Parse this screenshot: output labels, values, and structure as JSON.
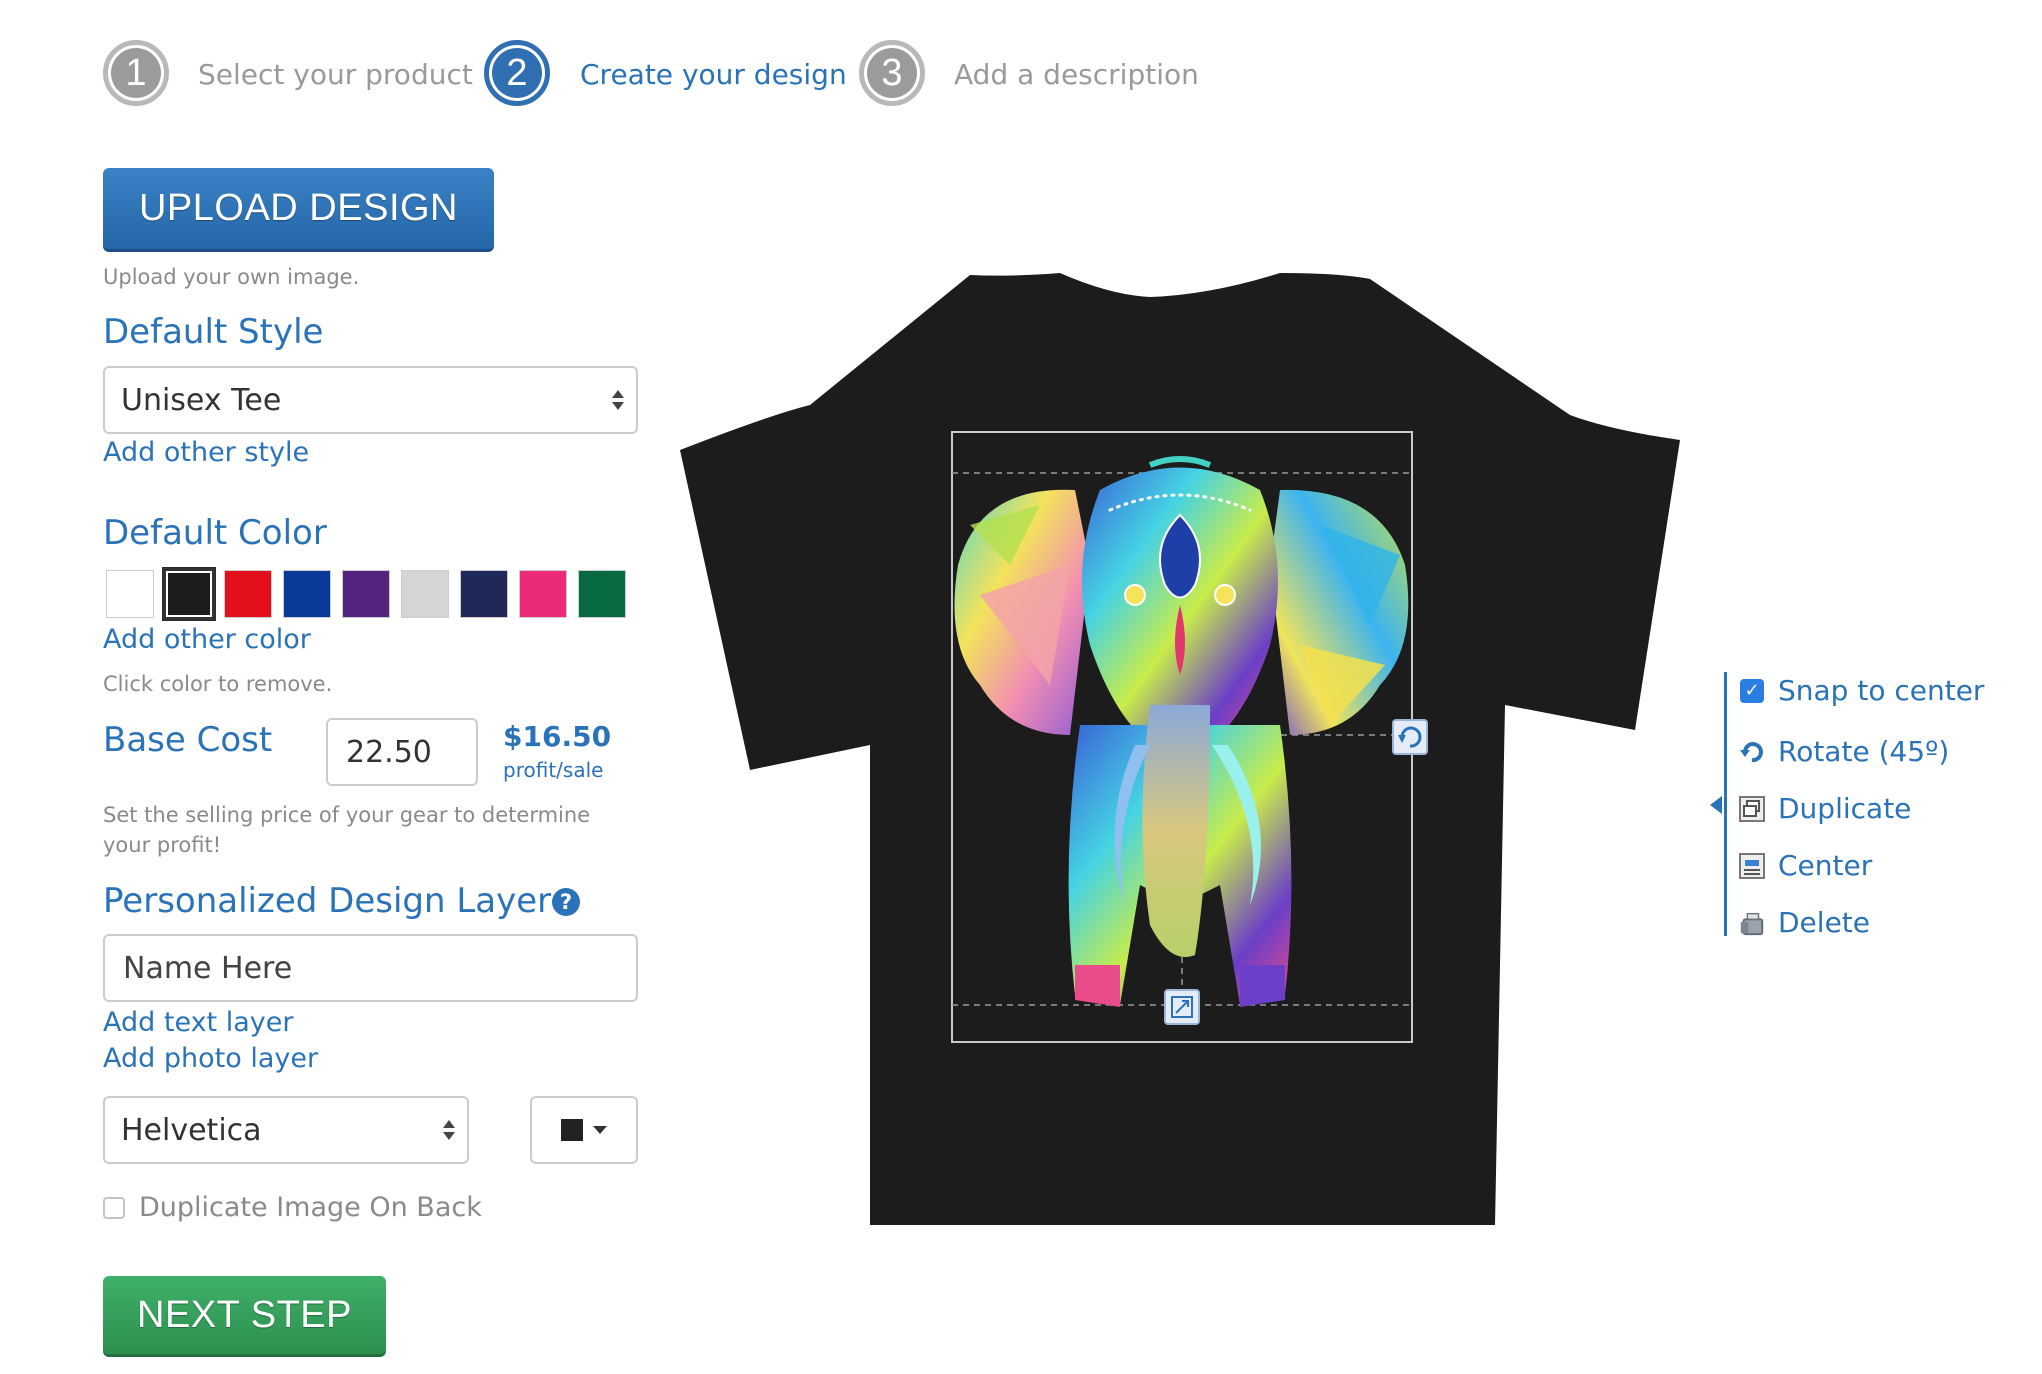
{
  "steps": [
    {
      "number": "1",
      "label": "Select your product",
      "active": false
    },
    {
      "number": "2",
      "label": "Create your design",
      "active": true
    },
    {
      "number": "3",
      "label": "Add a description",
      "active": false
    }
  ],
  "upload": {
    "button_label": "UPLOAD DESIGN",
    "help": "Upload your own image."
  },
  "style": {
    "title": "Default Style",
    "selected": "Unisex Tee",
    "add_link": "Add other style"
  },
  "color": {
    "title": "Default Color",
    "swatches": [
      "#ffffff",
      "#1c1c1c",
      "#e3101c",
      "#0a3a99",
      "#53247f",
      "#d5d5d5",
      "#20285a",
      "#ec2a7a",
      "#076a41"
    ],
    "selected_index": 1,
    "add_link": "Add other color",
    "help": "Click color to remove."
  },
  "cost": {
    "title": "Base Cost",
    "value": "22.50",
    "profit": "$16.50",
    "profit_label": "profit/sale",
    "help": "Set the selling price of your gear to determine your profit!"
  },
  "personalized": {
    "title": "Personalized Design Layer",
    "help_icon": "question-circle-icon",
    "name_placeholder": "Name Here",
    "add_text_link": "Add text layer",
    "add_photo_link": "Add photo layer",
    "font_selected": "Helvetica",
    "text_color": "#222222"
  },
  "duplicate_back": {
    "label": "Duplicate Image On Back",
    "checked": false
  },
  "next": {
    "button_label": "NEXT STEP"
  },
  "shirt": {
    "color": "#1c1c1c"
  },
  "tools": {
    "snap": {
      "label": "Snap to center",
      "checked": true
    },
    "rotate": {
      "label": "Rotate (45º)"
    },
    "duplicate": {
      "label": "Duplicate"
    },
    "center": {
      "label": "Center"
    },
    "delete": {
      "label": "Delete"
    }
  },
  "colors": {
    "accent": "#2a73b8",
    "upload_button": "#2b6fb3",
    "next_button": "#34a05c"
  }
}
